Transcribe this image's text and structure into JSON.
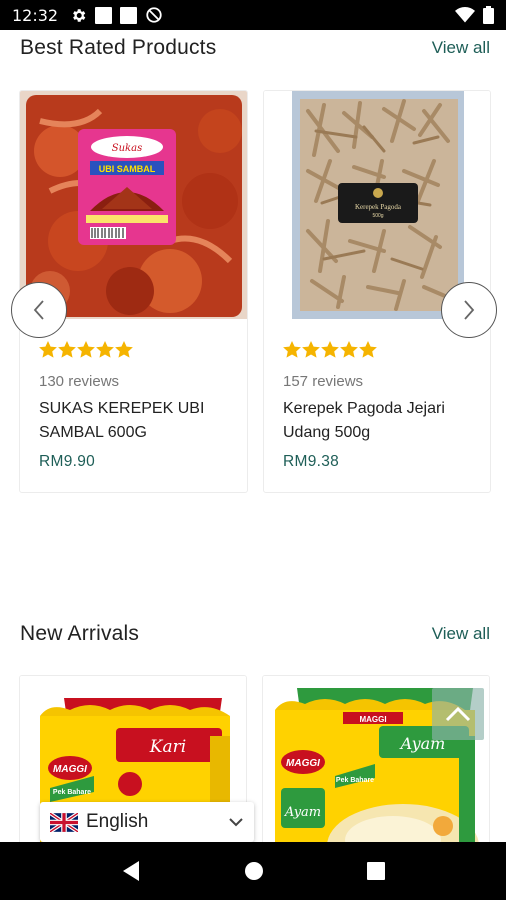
{
  "status_bar": {
    "time": "12:32"
  },
  "best_rated": {
    "title": "Best Rated Products",
    "view_all": "View all",
    "products": [
      {
        "stars": 5,
        "reviews": "130 reviews",
        "name": "SUKAS KEREPEK UBI SAMBAL 600G",
        "price": "RM9.90"
      },
      {
        "stars": 5,
        "reviews": "157 reviews",
        "name": "Kerepek Pagoda Jejari Udang 500g",
        "price": "RM9.38"
      }
    ]
  },
  "new_arrivals": {
    "title": "New Arrivals",
    "view_all": "View all",
    "products": [
      {
        "brand": "MAGGI",
        "flavour": "Kari",
        "tag": "Pek Bahare"
      },
      {
        "brand": "MAGGI",
        "flavour": "Ayam",
        "tag": "Pek Bahare"
      }
    ]
  },
  "language": {
    "selected": "English"
  },
  "colors": {
    "accent": "#1e5e57",
    "star": "#f5b400",
    "maggi_red": "#d71920",
    "maggi_yellow": "#ffd200",
    "maggi_green": "#2e9a3e"
  },
  "icons": [
    "gear-icon",
    "do-not-disturb-icon",
    "wifi-icon",
    "battery-icon",
    "chevron-left-icon",
    "chevron-right-icon",
    "chevron-up-icon",
    "chevron-down-icon",
    "uk-flag-icon",
    "back-icon",
    "home-icon",
    "recents-icon"
  ]
}
